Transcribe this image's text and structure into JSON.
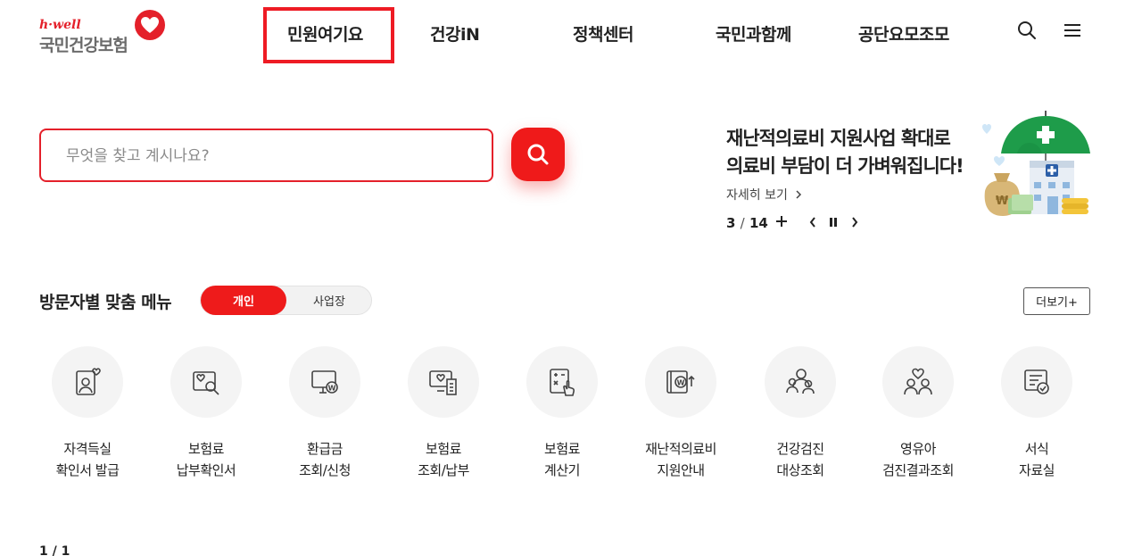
{
  "logo": {
    "tagline": "h·well",
    "name": "국민건강보험",
    "icon": "heart-logo-icon",
    "brand_color": "#e4202a"
  },
  "nav": {
    "items": [
      {
        "label": "민원여기요"
      },
      {
        "label": "건강iN"
      },
      {
        "label": "정책센터"
      },
      {
        "label": "국민과함께"
      },
      {
        "label": "공단요모조모"
      }
    ],
    "highlight_color": "#ee1b24",
    "icons": [
      "search-icon",
      "hamburger-menu-icon"
    ]
  },
  "search": {
    "placeholder": "무엇을 찾고 계시나요?",
    "value": "",
    "button_icon": "search-icon",
    "accent_color": "#ef1a1a"
  },
  "banner": {
    "title_line1": "재난적의료비 지원사업 확대로",
    "title_line2": "의료비 부담이 더 가벼워집니다!",
    "link": "자세히 보기",
    "current": "3",
    "separator": "/",
    "total": "14",
    "icons": [
      "plus-icon",
      "chevron-left-icon",
      "pause-icon",
      "chevron-right-icon",
      "umbrella-hospital-illustration"
    ]
  },
  "visitor_menu": {
    "title": "방문자별 맞춤 메뉴",
    "toggle": {
      "active": "개인",
      "inactive": "사업장"
    },
    "more": "더보기+",
    "items": [
      {
        "label": "자격득실\n확인서 발급",
        "icon": "id-card-heart-icon"
      },
      {
        "label": "보험료\n납부확인서",
        "icon": "document-search-icon"
      },
      {
        "label": "환급금\n조회/신청",
        "icon": "monitor-won-icon"
      },
      {
        "label": "보험료\n조회/납부",
        "icon": "monitor-receipt-icon"
      },
      {
        "label": "보험료\n계산기",
        "icon": "calculator-hand-icon"
      },
      {
        "label": "재난적의료비\n지원안내",
        "icon": "wallet-won-up-icon"
      },
      {
        "label": "건강검진\n대상조회",
        "icon": "people-group-icon"
      },
      {
        "label": "영유아\n검진결과조회",
        "icon": "parents-heart-icon"
      },
      {
        "label": "서식\n자료실",
        "icon": "form-check-icon"
      }
    ]
  },
  "pager": {
    "text": "1 / 1"
  }
}
